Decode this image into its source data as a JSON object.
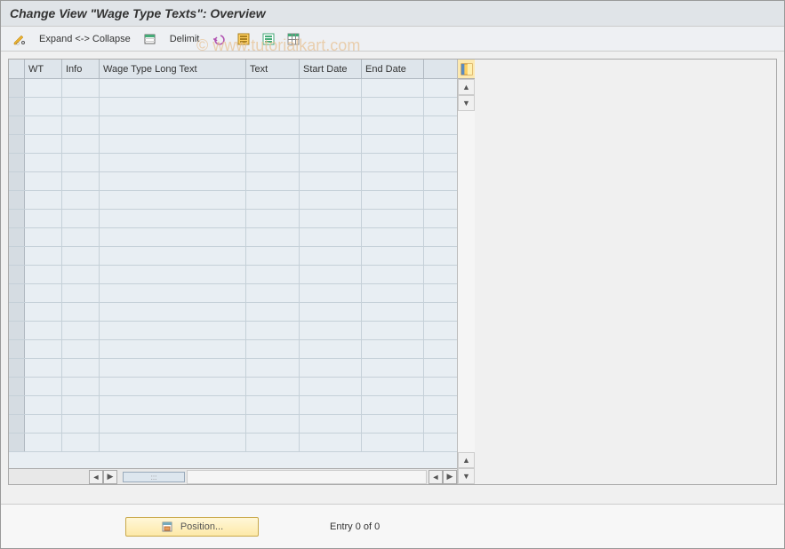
{
  "title": "Change View \"Wage Type Texts\": Overview",
  "toolbar": {
    "expand_collapse": "Expand <-> Collapse",
    "delimit": "Delimit"
  },
  "watermark": "© www.tutorialkart.com",
  "columns": {
    "wt": "WT",
    "info": "Info",
    "long": "Wage Type Long Text",
    "text": "Text",
    "start_date": "Start Date",
    "end_date": "End Date"
  },
  "chart_data": {
    "type": "table",
    "columns": [
      "WT",
      "Info",
      "Wage Type Long Text",
      "Text",
      "Start Date",
      "End Date"
    ],
    "rows": []
  },
  "row_count": 20,
  "footer": {
    "position_button": "Position...",
    "entry_text": "Entry 0 of 0"
  }
}
